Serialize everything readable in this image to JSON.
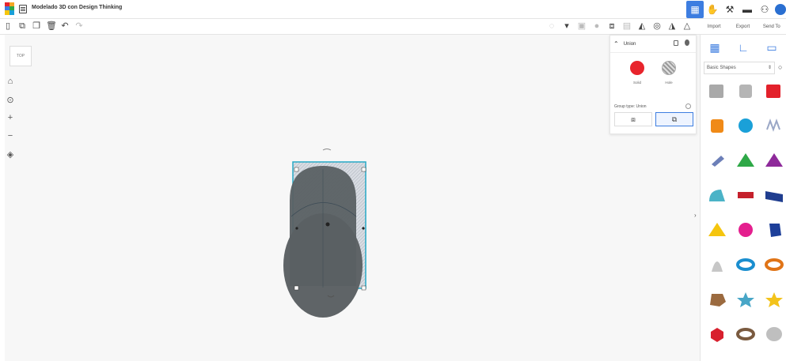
{
  "app": {
    "title": "Modelado 3D con Design Thinking"
  },
  "top_right": {
    "items": [
      "grid-view-icon",
      "hand-icon",
      "tools-icon",
      "briefcase-icon",
      "add-user-icon",
      "avatar"
    ]
  },
  "toolbar": {
    "left_icons": [
      "new-icon",
      "copy-icon",
      "duplicate-icon",
      "delete-icon",
      "undo-icon",
      "redo-icon"
    ],
    "right_icons": [
      "light-icon",
      "dropdown-icon",
      "note-icon",
      "hole-icon",
      "group-icon",
      "align-icon",
      "mirror-icon",
      "workplane-icon",
      "ruler-icon",
      "cruise-icon"
    ]
  },
  "side_head": {
    "import_label": "Import",
    "export_label": "Export",
    "send_label": "Send To"
  },
  "viewcube": {
    "label": "TOP"
  },
  "inspector": {
    "title": "Union",
    "solid_label": "Solid",
    "hole_label": "Hole",
    "group_type_label": "Group type: Union"
  },
  "shapes_panel": {
    "category_select": "Basic Shapes",
    "shapes": [
      {
        "name": "box-hole",
        "color": "#a9a9a9"
      },
      {
        "name": "cylinder-hole",
        "color": "#b5b5b5"
      },
      {
        "name": "box",
        "color": "#e3212b"
      },
      {
        "name": "cylinder",
        "color": "#f08a17"
      },
      {
        "name": "sphere",
        "color": "#1aa0d8"
      },
      {
        "name": "scribble",
        "color": "#9aa7c6"
      },
      {
        "name": "text-shape",
        "color": "#6c7fb8"
      },
      {
        "name": "roof",
        "color": "#2ea847"
      },
      {
        "name": "cone-pyramid",
        "color": "#8e2a9a"
      },
      {
        "name": "round-roof",
        "color": "#4bb3c7"
      },
      {
        "name": "text",
        "color": "#c5202c"
      },
      {
        "name": "wedge",
        "color": "#1f3d8f"
      },
      {
        "name": "pyramid",
        "color": "#f5c50e"
      },
      {
        "name": "half-sphere",
        "color": "#e41f8e"
      },
      {
        "name": "polygon",
        "color": "#1d3f99"
      },
      {
        "name": "paraboloid",
        "color": "#c7c7c7"
      },
      {
        "name": "torus",
        "color": "#1a8ecf"
      },
      {
        "name": "tube",
        "color": "#e07417"
      },
      {
        "name": "icosahedron",
        "color": "#9b6a3f"
      },
      {
        "name": "star",
        "color": "#48a6c7"
      },
      {
        "name": "star-yellow",
        "color": "#f3c31b"
      },
      {
        "name": "heart",
        "color": "#d8202e"
      },
      {
        "name": "ring",
        "color": "#7a5a3f"
      },
      {
        "name": "ellipsoid",
        "color": "#bfbfbf"
      }
    ]
  }
}
